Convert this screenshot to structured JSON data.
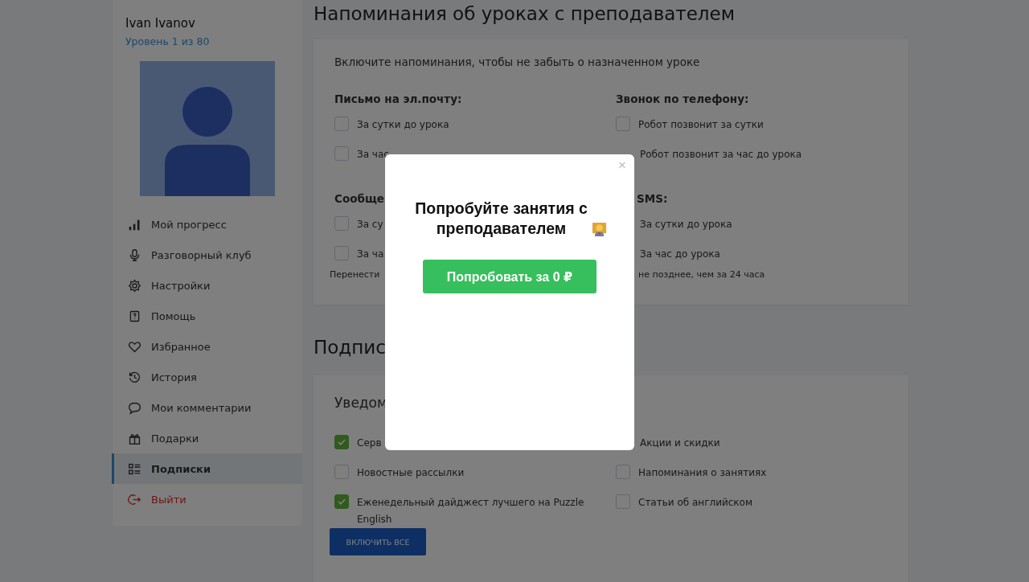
{
  "sidebar": {
    "user_name": "Ivan Ivanov",
    "level": "Уровень 1 из 80",
    "items": [
      {
        "label": "Мой прогресс",
        "selected": false,
        "kind": "link"
      },
      {
        "label": "Разговорный клуб",
        "selected": false,
        "kind": "link"
      },
      {
        "label": "Настройки",
        "selected": false,
        "kind": "link"
      },
      {
        "label": "Помощь",
        "selected": false,
        "kind": "link"
      },
      {
        "label": "Избранное",
        "selected": false,
        "kind": "link"
      },
      {
        "label": "История",
        "selected": false,
        "kind": "link"
      },
      {
        "label": "Мои комментарии",
        "selected": false,
        "kind": "link"
      },
      {
        "label": "Подарки",
        "selected": false,
        "kind": "link"
      },
      {
        "label": "Подписки",
        "selected": true,
        "kind": "link"
      },
      {
        "label": "Выйти",
        "selected": false,
        "kind": "logout"
      }
    ]
  },
  "reminders": {
    "title": "Напоминания об уроках с преподавателем",
    "intro": "Включите напоминания, чтобы не забыть о назначенном уроке",
    "groups": [
      {
        "title": "Письмо на эл.почту:",
        "options": [
          {
            "label": "За сутки до урока",
            "checked": false
          },
          {
            "label": "За час",
            "checked": false
          }
        ]
      },
      {
        "title": "Звонок по телефону:",
        "options": [
          {
            "label": "Робот позвонит за сутки",
            "checked": false
          },
          {
            "label": "Робот позвонит за час до урока"
          }
        ]
      },
      {
        "title": "Сообще",
        "options": [
          {
            "label": "За су",
            "checked": false
          },
          {
            "label": "За ча",
            "checked": false
          }
        ]
      },
      {
        "title": "SMS:",
        "options": [
          {
            "label": "За сутки до урока"
          },
          {
            "label": "За час до урока"
          }
        ]
      }
    ],
    "note_left": "Перенести",
    "note_right": "не позднее, чем за 24 часа"
  },
  "subscriptions": {
    "title": "Подпис",
    "card_title": "Уведом",
    "options": [
      {
        "label": "Серв",
        "checked": true
      },
      {
        "label": "Акции и скидки"
      },
      {
        "label": "Новостные рассылки",
        "checked": false
      },
      {
        "label": "Напоминания о занятиях",
        "checked": false
      },
      {
        "label": "Еженедельный дайджест лучшего на Puzzle English",
        "checked": true
      },
      {
        "label": "Статьи об английском",
        "checked": false
      }
    ],
    "button": "ВКЛЮЧИТЬ ВСЕ"
  },
  "modal": {
    "close": "×",
    "title": "Попробуйте занятия с преподавателем",
    "button": "Попробовать за 0 ₽"
  }
}
